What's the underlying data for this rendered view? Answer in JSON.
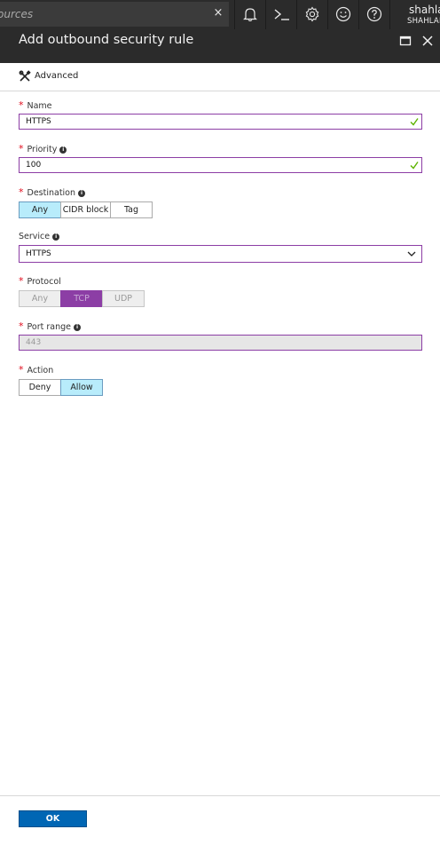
{
  "topbar": {
    "search_text": "ources",
    "clear_glyph": "×",
    "icons": [
      "notifications-icon",
      "cloud-shell-icon",
      "settings-icon",
      "feedback-icon",
      "help-icon"
    ],
    "user_name": "shahla",
    "user_org": "SHAHLAI"
  },
  "blade": {
    "title": "Add outbound security rule"
  },
  "command_bar": {
    "advanced_label": "Advanced"
  },
  "form": {
    "name": {
      "label": "Name",
      "required": "*",
      "value": "HTTPS"
    },
    "priority": {
      "label": "Priority",
      "required": "*",
      "value": "100"
    },
    "destination": {
      "label": "Destination",
      "required": "*",
      "options": [
        "Any",
        "CIDR block",
        "Tag"
      ],
      "selected": "Any"
    },
    "service": {
      "label": "Service",
      "value": "HTTPS"
    },
    "protocol": {
      "label": "Protocol",
      "required": "*",
      "options": [
        "Any",
        "TCP",
        "UDP"
      ],
      "selected": "TCP"
    },
    "port_range": {
      "label": "Port range",
      "required": "*",
      "value": "443"
    },
    "action": {
      "label": "Action",
      "required": "*",
      "options": [
        "Deny",
        "Allow"
      ],
      "selected": "Allow"
    }
  },
  "footer": {
    "ok_label": "OK"
  },
  "colors": {
    "topbar_bg": "#2b2b2b",
    "field_border": "#8c3ea5",
    "selected_toggle": "#b8ecfb",
    "primary_button": "#0066b4",
    "required_star": "#e00b1c",
    "valid_check": "#5db300"
  }
}
